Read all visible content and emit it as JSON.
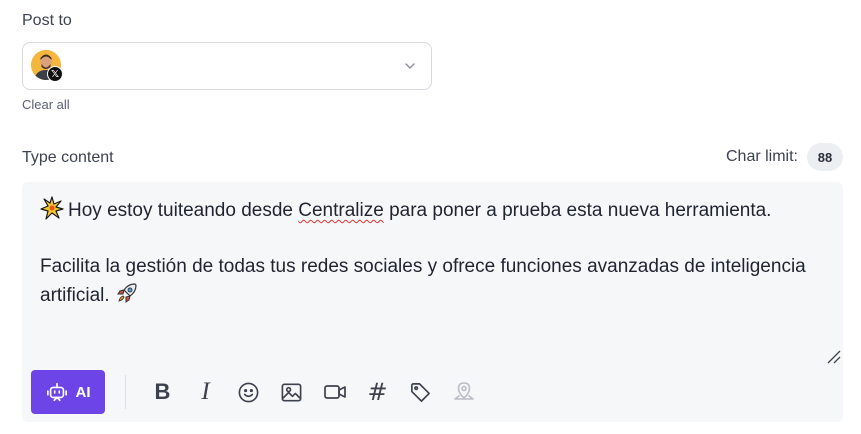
{
  "post_to": {
    "label": "Post to",
    "account": {
      "network_icon": "x-logo-icon",
      "network_glyph": "𝕏"
    },
    "clear_all": "Clear all"
  },
  "content": {
    "label": "Type content",
    "char_limit_label": "Char limit:",
    "char_limit_value": "88",
    "line1": "Hoy estoy tuiteando desde ",
    "line1_highlight": "Centralize",
    "line1_rest": " para poner a prueba esta nueva herramienta.",
    "line2": "Facilita la gestión de todas tus redes sociales y ofrece funciones avanzadas de inteligencia artificial.",
    "emoji_start": "sparkle-burst-icon",
    "emoji_end": "rocket-icon"
  },
  "toolbar": {
    "ai_label": "AI",
    "tools": [
      "bold-icon",
      "italic-icon",
      "emoji-icon",
      "image-icon",
      "video-icon",
      "hashtag-icon",
      "tag-icon",
      "location-icon"
    ]
  },
  "colors": {
    "accent": "#6d44e8",
    "editor_bg": "#f6f7f9",
    "border": "#d6d9df",
    "avatar_bg": "#f4b63c"
  }
}
